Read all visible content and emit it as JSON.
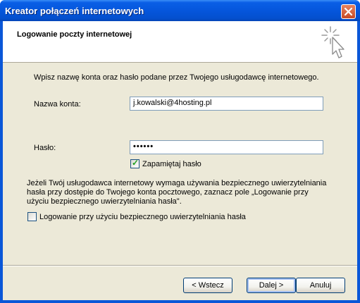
{
  "window": {
    "title": "Kreator połączeń internetowych"
  },
  "header": {
    "title": "Logowanie poczty internetowej",
    "icon": "wizard-sparkle-cursor-icon"
  },
  "intro_text": "Wpisz nazwę konta oraz hasło podane przez Twojego usługodawcę internetowego.",
  "account": {
    "label": "Nazwa konta:",
    "value": "j.kowalski@4hosting.pl"
  },
  "password": {
    "label": "Hasło:",
    "value": "••••••"
  },
  "remember_password": {
    "label": "Zapamiętaj hasło",
    "checked": true
  },
  "spa_info": {
    "lines": [
      "Jeżeli Twój usługodawca internetowy wymaga używania bezpiecznego uwierzytelniania",
      "hasła przy dostępie do Twojego konta pocztowego, zaznacz pole „Logowanie przy",
      "użyciu bezpiecznego uwierzytelniania hasła\"."
    ]
  },
  "spa_checkbox": {
    "label": "Logowanie przy użyciu bezpiecznego uwierzytelniania hasła",
    "checked": false
  },
  "buttons": {
    "back": "< Wstecz",
    "next": "Dalej >",
    "cancel": "Anuluj"
  },
  "colors": {
    "titlebar": "#0556dc",
    "dialog_bg": "#ece9d8",
    "close_button": "#c74a25"
  }
}
